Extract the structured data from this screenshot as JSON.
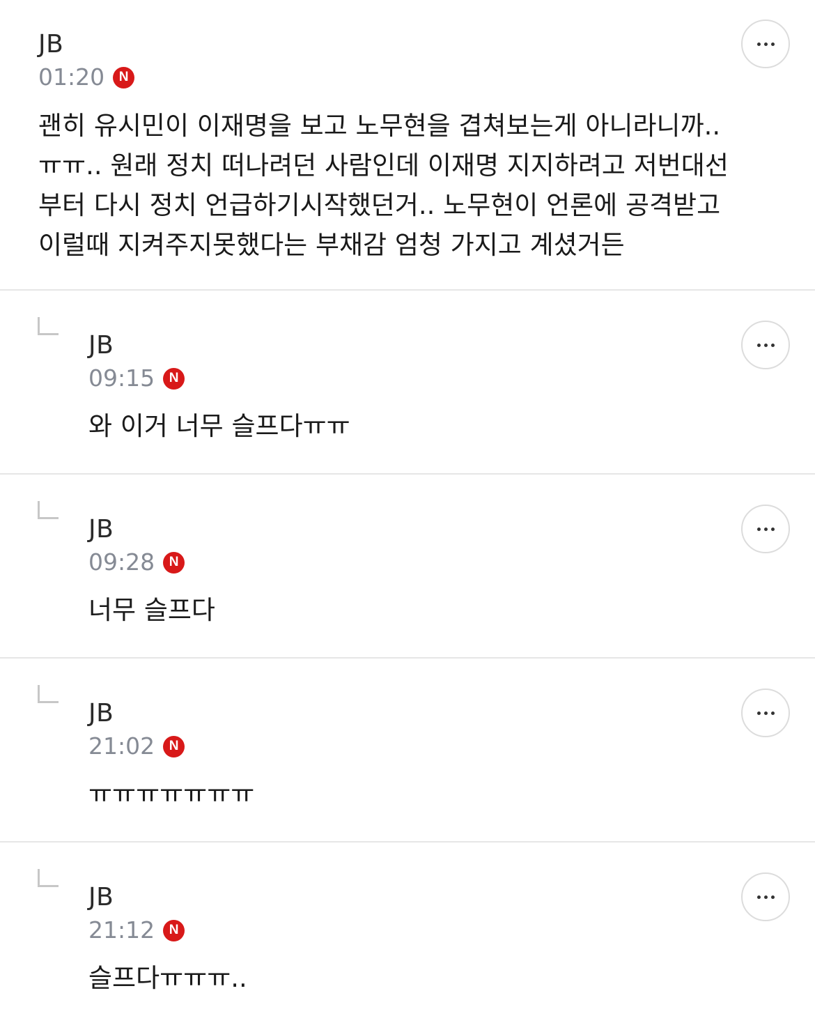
{
  "comments": [
    {
      "author": "JB",
      "time": "01:20",
      "badge": "N",
      "text": "괜히 유시민이 이재명을 보고 노무현을 겹쳐보는게 아니라니까..\nㅠㅠ.. 원래 정치 떠나려던 사람인데 이재명 지지하려고 저번대선\n부터 다시 정치 언급하기시작했던거.. 노무현이 언론에 공격받고\n이럴때 지켜주지못했다는 부채감 엄청 가지고 계셨거든",
      "more_icon": "more-horizontal-icon"
    },
    {
      "author": "JB",
      "time": "09:15",
      "badge": "N",
      "text": "와 이거 너무 슬프다ㅠㅠ",
      "reply_icon": "reply-corner-icon",
      "more_icon": "more-horizontal-icon"
    },
    {
      "author": "JB",
      "time": "09:28",
      "badge": "N",
      "text": "너무 슬프다",
      "reply_icon": "reply-corner-icon",
      "more_icon": "more-horizontal-icon"
    },
    {
      "author": "JB",
      "time": "21:02",
      "badge": "N",
      "text": "ㅠㅠㅠㅠㅠㅠㅠ",
      "reply_icon": "reply-corner-icon",
      "more_icon": "more-horizontal-icon"
    },
    {
      "author": "JB",
      "time": "21:12",
      "badge": "N",
      "text": "슬프다ㅠㅠㅠ..",
      "reply_icon": "reply-corner-icon",
      "more_icon": "more-horizontal-icon"
    }
  ],
  "colors": {
    "badge": "#d81919",
    "time": "#858a94",
    "divider": "#e6e6e6"
  }
}
